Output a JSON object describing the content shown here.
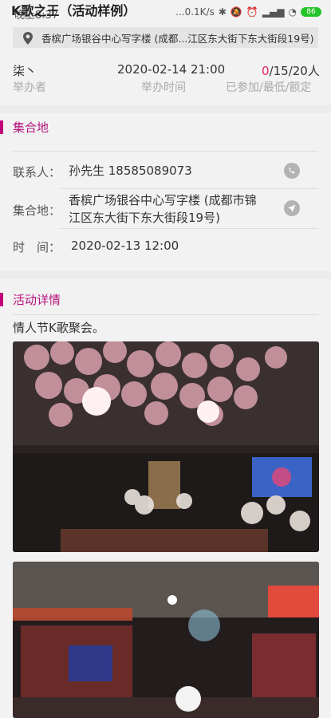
{
  "status": {
    "title_overlay": "K歌之王（活动样例）",
    "time": "晚上8:37",
    "network": "...0.1K/s",
    "battery": "86"
  },
  "location": {
    "address": "香槟广场银谷中心写字楼 (成都...江区东大街下东大街段19号)"
  },
  "stats": {
    "organizer": "柒丶",
    "organizer_label": "举办者",
    "datetime": "2020-02-14 21:00",
    "datetime_label": "举办时间",
    "joined": "0",
    "capacity": "/15/20人",
    "capacity_label": "已参加/最低/额定"
  },
  "meeting": {
    "section_title": "集合地",
    "contact_label": "联系人：",
    "contact_value": "孙先生 18585089073",
    "place_label": "集合地：",
    "place_line1": "香槟广场银谷中心写字楼 (成都市锦",
    "place_line2": "江区东大街下东大街段19号)",
    "time_label": "时　间：",
    "time_value": "2020-02-13 12:00"
  },
  "details": {
    "section_title": "活动详情",
    "description": "情人节K歌聚会。"
  },
  "colors": {
    "accent": "#c2007a",
    "joined": "#e0245e"
  }
}
